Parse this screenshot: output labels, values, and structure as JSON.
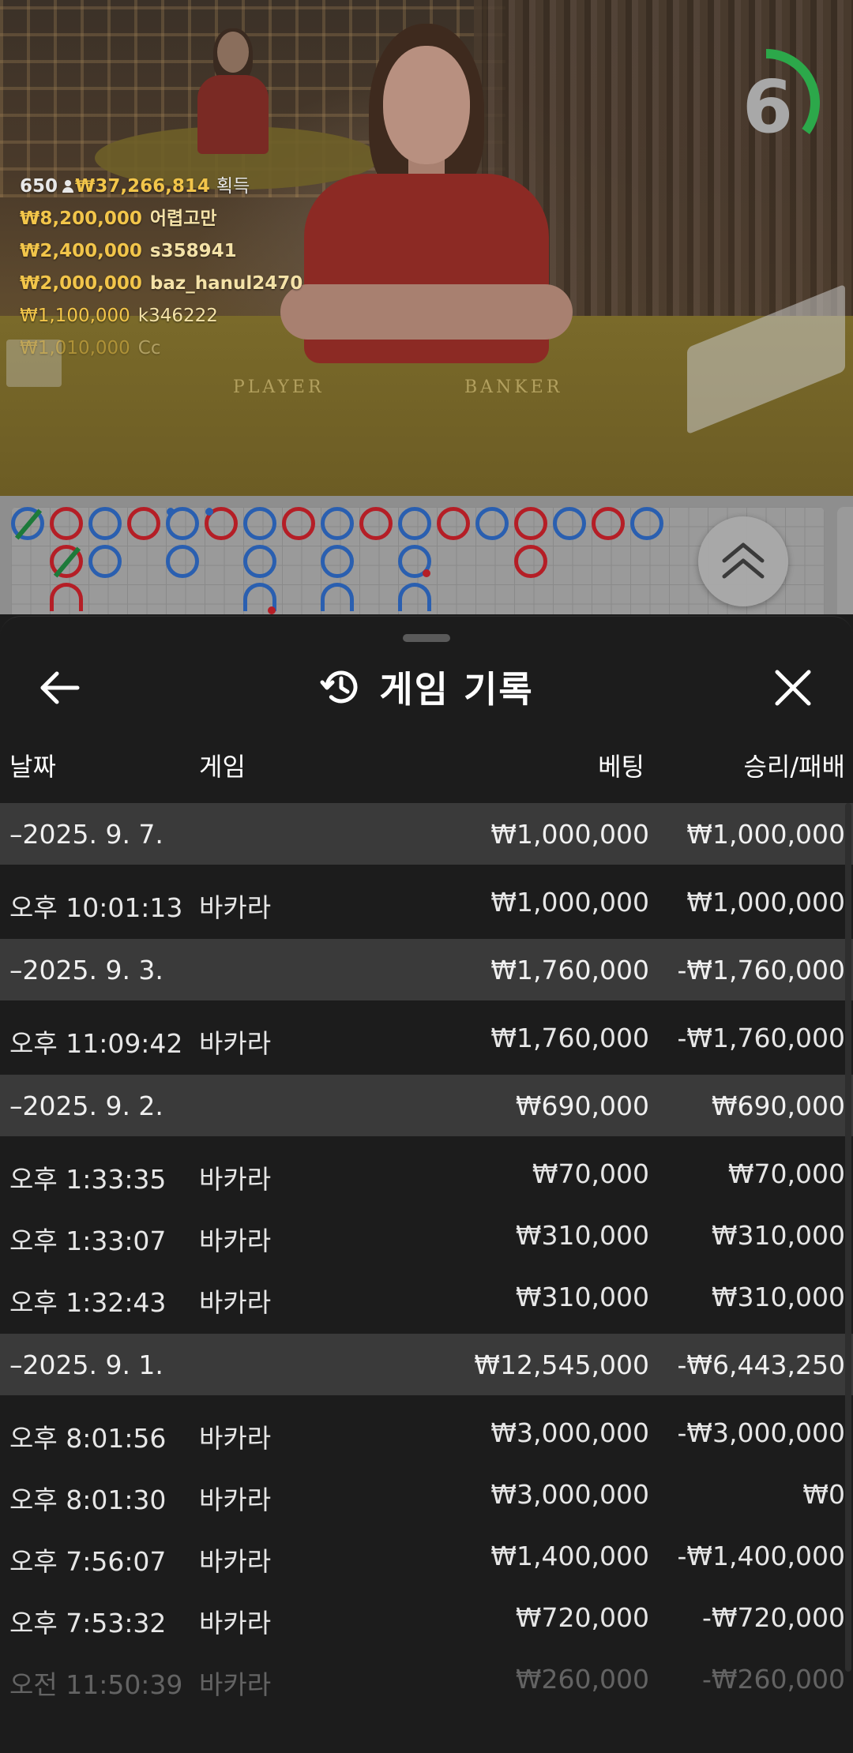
{
  "video": {
    "table_labels": {
      "player": "PLAYER",
      "banker": "BANKER"
    },
    "timer": {
      "value": "6",
      "progress": 0.35,
      "color": "#2ca84a"
    },
    "bets_summary": {
      "count": "650",
      "total": "₩37,266,814",
      "label": "획득"
    },
    "top_bets": [
      {
        "amount": "₩8,200,000",
        "name": "어렵고만"
      },
      {
        "amount": "₩2,400,000",
        "name": "s358941"
      },
      {
        "amount": "₩2,000,000",
        "name": "baz_hanul2470"
      },
      {
        "amount": "₩1,100,000",
        "name": "k346222"
      },
      {
        "amount": "₩1,010,000",
        "name": "Cc"
      }
    ]
  },
  "roadmap": {
    "colors": {
      "banker": "#b51e26",
      "player": "#2a5fb0",
      "tie": "#1d7a3a"
    },
    "expand_icon": "double-chevron-up-icon"
  },
  "sheet": {
    "title": "게임 기록",
    "title_icon": "history-icon",
    "back_icon": "arrow-left-icon",
    "close_icon": "close-icon",
    "columns": {
      "date": "날짜",
      "game": "게임",
      "bet": "베팅",
      "result": "승리/패배"
    },
    "groups": [
      {
        "date": "–2025. 9. 7.",
        "bet": "₩1,000,000",
        "result": "₩1,000,000",
        "rows": [
          {
            "time": "오후 10:01:13",
            "game": "바카라",
            "bet": "₩1,000,000",
            "result": "₩1,000,000"
          }
        ]
      },
      {
        "date": "–2025. 9. 3.",
        "bet": "₩1,760,000",
        "result": "-₩1,760,000",
        "rows": [
          {
            "time": "오후 11:09:42",
            "game": "바카라",
            "bet": "₩1,760,000",
            "result": "-₩1,760,000"
          }
        ]
      },
      {
        "date": "–2025. 9. 2.",
        "bet": "₩690,000",
        "result": "₩690,000",
        "rows": [
          {
            "time": "오후 1:33:35",
            "game": "바카라",
            "bet": "₩70,000",
            "result": "₩70,000"
          },
          {
            "time": "오후 1:33:07",
            "game": "바카라",
            "bet": "₩310,000",
            "result": "₩310,000"
          },
          {
            "time": "오후 1:32:43",
            "game": "바카라",
            "bet": "₩310,000",
            "result": "₩310,000"
          }
        ]
      },
      {
        "date": "–2025. 9. 1.",
        "bet": "₩12,545,000",
        "result": "-₩6,443,250",
        "rows": [
          {
            "time": "오후 8:01:56",
            "game": "바카라",
            "bet": "₩3,000,000",
            "result": "-₩3,000,000"
          },
          {
            "time": "오후 8:01:30",
            "game": "바카라",
            "bet": "₩3,000,000",
            "result": "₩0"
          },
          {
            "time": "오후 7:56:07",
            "game": "바카라",
            "bet": "₩1,400,000",
            "result": "-₩1,400,000"
          },
          {
            "time": "오후 7:53:32",
            "game": "바카라",
            "bet": "₩720,000",
            "result": "-₩720,000"
          },
          {
            "time": "오전 11:50:39",
            "game": "바카라",
            "bet": "₩260,000",
            "result": "-₩260,000"
          }
        ]
      }
    ]
  }
}
